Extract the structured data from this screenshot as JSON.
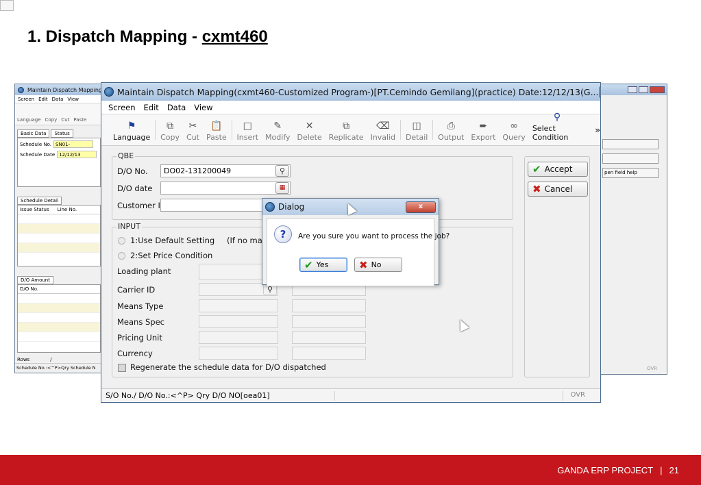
{
  "slide": {
    "title_prefix": "1. Dispatch Mapping - ",
    "title_code": "cxmt460"
  },
  "bg_left": {
    "title": "Maintain Dispatch Mapping(",
    "menu": [
      "Screen",
      "Edit",
      "Data",
      "View"
    ],
    "toolbar": [
      "Language",
      "Copy",
      "Cut",
      "Paste"
    ],
    "tabs": [
      "Basic Data",
      "Status"
    ],
    "schedule_no_label": "Schedule No.",
    "schedule_no_value": "SN01-",
    "schedule_date_label": "Schedule Date",
    "schedule_date_value": "12/12/13",
    "detail_tab": "Schedule Detail",
    "detail_cols": [
      "Issue Status",
      "Line No."
    ],
    "amount_tab": "D/O Amount",
    "amount_col": "D/O No.",
    "rows_label": "Rows",
    "rows_sep": "/",
    "status": "Schedule No.:<^P>Qry Schedule N"
  },
  "bg_right": {
    "help_text": "pen field help",
    "ovr": "OVR"
  },
  "main": {
    "title": "Maintain Dispatch Mapping(cxmt460-Customized Program-)[PT.Cemindo Gemilang](practice)  Date:12/12/13(G...",
    "menu": [
      "Screen",
      "Edit",
      "Data",
      "View"
    ],
    "toolbar": [
      {
        "label": "Language",
        "icon": "flag-icon"
      },
      {
        "label": "Copy",
        "icon": "copy-icon"
      },
      {
        "label": "Cut",
        "icon": "scissors-icon"
      },
      {
        "label": "Paste",
        "icon": "paste-icon"
      },
      {
        "label": "Insert",
        "icon": "new-doc-icon"
      },
      {
        "label": "Modify",
        "icon": "pencil-icon"
      },
      {
        "label": "Delete",
        "icon": "x-icon"
      },
      {
        "label": "Replicate",
        "icon": "duplicate-icon"
      },
      {
        "label": "Invalid",
        "icon": "trash-icon"
      },
      {
        "label": "Detail",
        "icon": "detail-icon"
      },
      {
        "label": "Output",
        "icon": "printer-icon"
      },
      {
        "label": "Export",
        "icon": "export-icon"
      },
      {
        "label": "Query",
        "icon": "binoculars-icon"
      },
      {
        "label": "Select Condition",
        "icon": "magnifier-doc-icon"
      }
    ],
    "more": "»",
    "qbe": {
      "label": "QBE",
      "do_no_label": "D/O No.",
      "do_no_value": "DO02-131200049",
      "do_date_label": "D/O date",
      "customer_label": "Customer ID"
    },
    "input": {
      "label": "INPUT",
      "opt1": "1:Use Default Setting",
      "opt1_note": "(If no map",
      "opt2": "2:Set Price Condition",
      "loading_plant": "Loading plant",
      "carrier": "Carrier ID",
      "means_type": "Means Type",
      "means_spec": "Means Spec",
      "pricing_unit": "Pricing Unit",
      "currency": "Currency",
      "regen": "Regenerate the schedule data for D/O dispatched"
    },
    "accept": "Accept",
    "cancel": "Cancel",
    "status": "S/O No./ D/O No.:<^P> Qry D/O NO[oea01]",
    "ovr": "OVR"
  },
  "dialog": {
    "title": "Dialog",
    "close": "x",
    "message": "Are you sure you want to process the job?",
    "yes": "Yes",
    "no": "No"
  },
  "footer": {
    "project": "GANDA ERP PROJECT",
    "sep": "|",
    "page": "21"
  },
  "colors": {
    "footer_bg": "#c4161c",
    "highlight_field": "#ffffa8",
    "accept_check": "#1f9a1f",
    "cancel_x": "#c8211a"
  }
}
